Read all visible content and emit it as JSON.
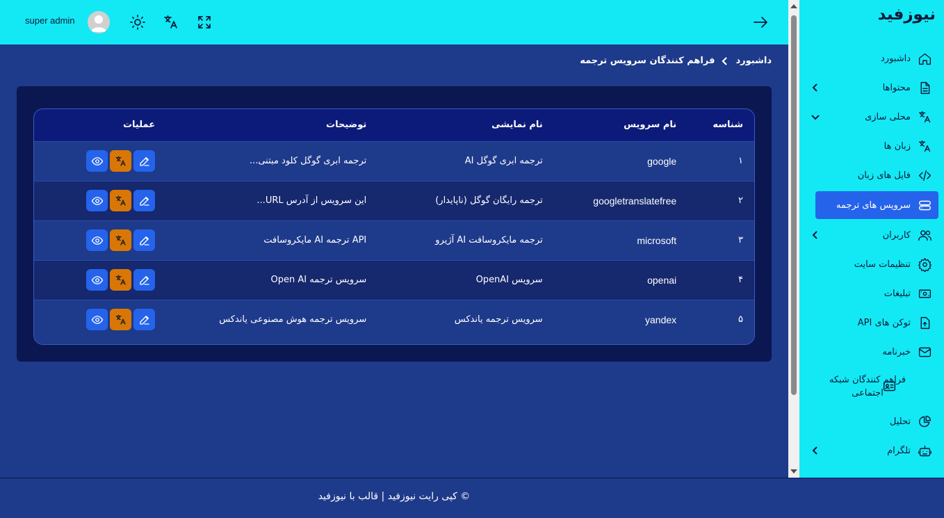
{
  "sidebar": {
    "brand": "نیوزفید",
    "items": [
      {
        "label": "داشبورد",
        "icon": "home-icon",
        "chevron": null
      },
      {
        "label": "محتواها",
        "icon": "document-icon",
        "chevron": "left"
      },
      {
        "label": "محلی سازی",
        "icon": "translate-icon",
        "chevron": "down"
      },
      {
        "label": "زبان ها",
        "icon": "translate-icon",
        "chevron": null
      },
      {
        "label": "فایل های زبان",
        "icon": "code-icon",
        "chevron": null
      },
      {
        "label": "سرویس های ترجمه",
        "icon": "server-icon",
        "chevron": null,
        "active": true
      },
      {
        "label": "کاربران",
        "icon": "users-icon",
        "chevron": "left"
      },
      {
        "label": "تنظیمات سایت",
        "icon": "gear-icon",
        "chevron": null
      },
      {
        "label": "تبلیغات",
        "icon": "money-icon",
        "chevron": null
      },
      {
        "label": "توکن های API",
        "icon": "token-icon",
        "chevron": null
      },
      {
        "label": "خبرنامه",
        "icon": "mail-icon",
        "chevron": null
      },
      {
        "label": "فراهم کنندگان شبکه اجتماعی",
        "icon": "id-card-icon",
        "chevron": null
      },
      {
        "label": "تحلیل",
        "icon": "pie-chart-icon",
        "chevron": null
      },
      {
        "label": "تلگرام",
        "icon": "bot-icon",
        "chevron": "left"
      }
    ]
  },
  "header": {
    "user_name": "super admin"
  },
  "breadcrumb": {
    "root": "داشبورد",
    "current": "فراهم کنندگان سرویس ترجمه"
  },
  "table": {
    "columns": [
      "شناسه",
      "نام سرویس",
      "نام نمایشی",
      "توضیحات",
      "عملیات"
    ],
    "rows": [
      {
        "id": "۱",
        "name": "google",
        "display": "ترجمه ابری گوگل AI",
        "desc": "ترجمه ابری گوگل کلود مبتنی..."
      },
      {
        "id": "۲",
        "name": "googletranslatefree",
        "display": "ترجمه رایگان گوگل (ناپایدار)",
        "desc": "این سرویس از آدرس URL..."
      },
      {
        "id": "۳",
        "name": "microsoft",
        "display": "ترجمه مایکروسافت AI آژیرو",
        "desc": "API ترجمه AI مایکروسافت"
      },
      {
        "id": "۴",
        "name": "openai",
        "display": "سرویس OpenAI",
        "desc": "سرویس ترجمه Open AI"
      },
      {
        "id": "۵",
        "name": "yandex",
        "display": "سرویس ترجمه یاندکس",
        "desc": "سرویس ترجمه هوش مصنوعی یاندکس"
      }
    ]
  },
  "footer": {
    "text": "© کپی رایت نیوزفید | قالب با نیوزفید"
  },
  "colors": {
    "accent": "#13e9f4",
    "background": "#1e3a8a",
    "card": "#0b1750",
    "active": "#2563eb",
    "translate_button": "#d97706"
  }
}
